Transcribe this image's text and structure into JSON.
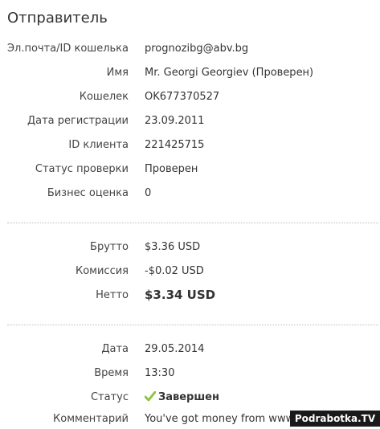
{
  "section_title": "Отправитель",
  "sender": {
    "email_label": "Эл.почта/ID кошелька",
    "email_value": "prognozibg@abv.bg",
    "name_label": "Имя",
    "name_value": "Mr. Georgi Georgiev (Проверен)",
    "wallet_label": "Кошелек",
    "wallet_value": "OK677370527",
    "reg_date_label": "Дата регистрации",
    "reg_date_value": "23.09.2011",
    "client_id_label": "ID клиента",
    "client_id_value": "221425715",
    "verify_status_label": "Статус проверки",
    "verify_status_value": "Проверен",
    "business_rating_label": "Бизнес оценка",
    "business_rating_value": "0"
  },
  "amounts": {
    "gross_label": "Брутто",
    "gross_value": "$3.36 USD",
    "fee_label": "Комиссия",
    "fee_value": "-$0.02 USD",
    "net_label": "Нетто",
    "net_value": "$3.34 USD"
  },
  "details": {
    "date_label": "Дата",
    "date_value": "29.05.2014",
    "time_label": "Время",
    "time_value": "13:30",
    "status_label": "Статус",
    "status_value": "Завершен",
    "status_icon": "checkmark-icon",
    "comment_label": "Комментарий",
    "comment_value": "You've got money from www.B"
  },
  "watermark": "Podrabotka.TV",
  "colors": {
    "check_green": "#8cc63f"
  }
}
